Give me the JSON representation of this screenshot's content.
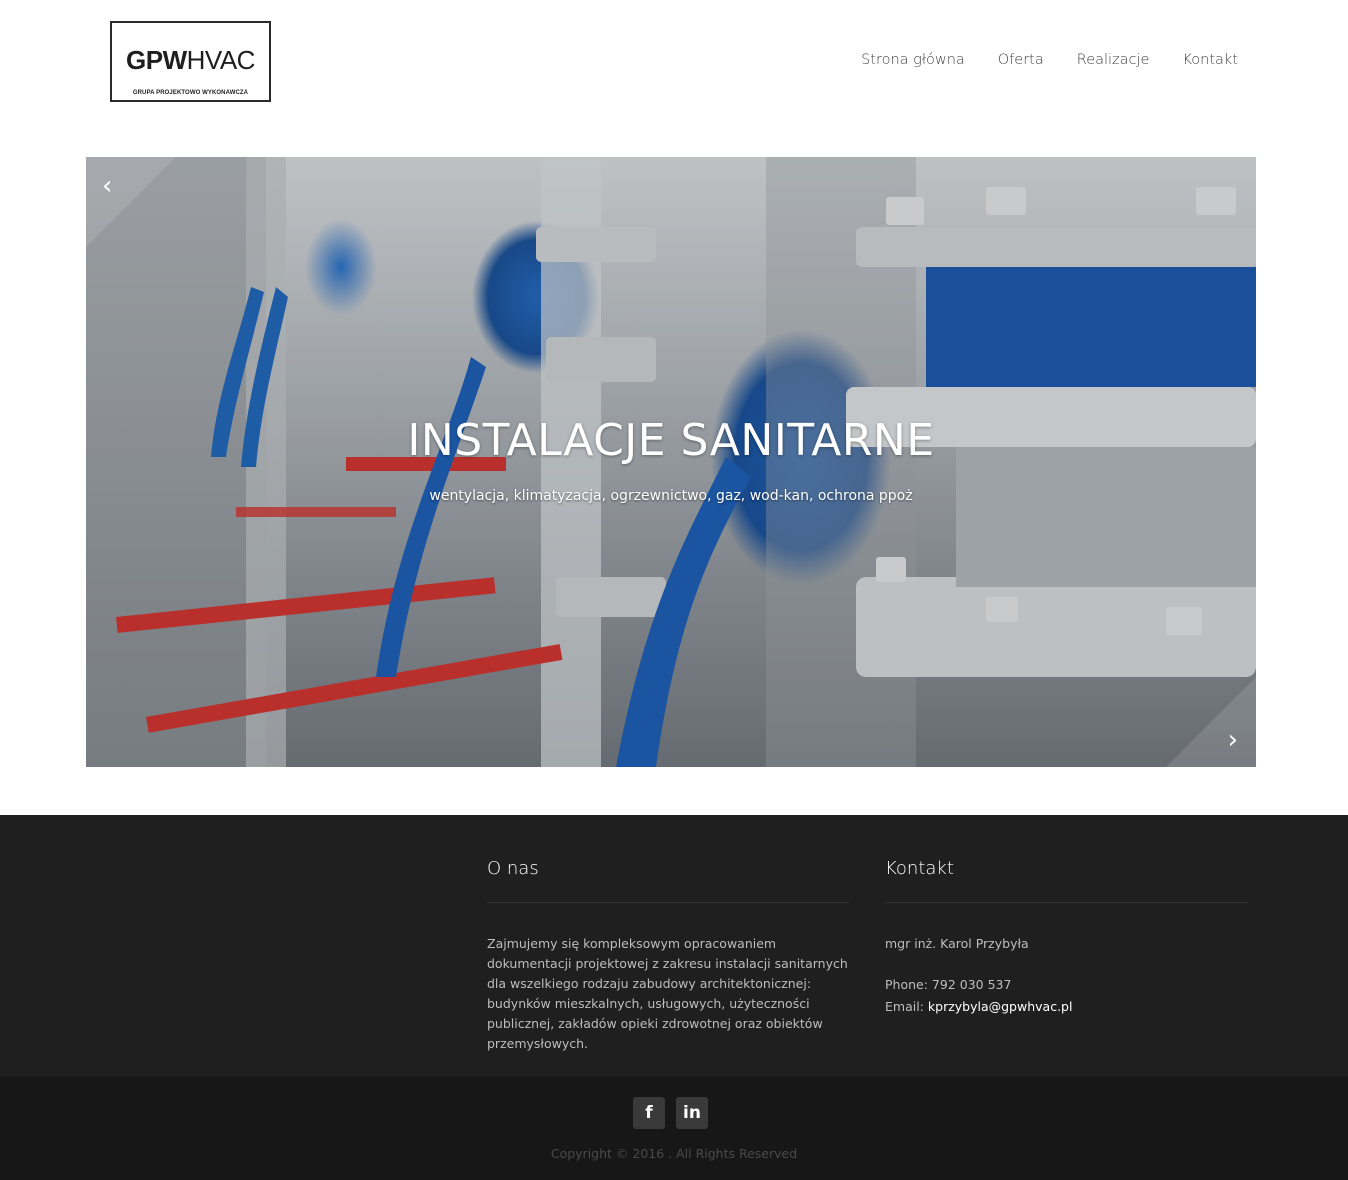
{
  "logo": {
    "title_bold": "GPW",
    "title_light": "HVAC",
    "subtitle": "GRUPA PROJEKTOWO WYKONAWCZA"
  },
  "nav": [
    {
      "label": "Strona główna"
    },
    {
      "label": "Oferta"
    },
    {
      "label": "Realizacje"
    },
    {
      "label": "Kontakt"
    }
  ],
  "slider": {
    "title": "INSTALACJE SANITARNE",
    "subtitle": "wentylacja, klimatyzacja, ogrzewnictwo, gaz, wod-kan, ochrona ppoż",
    "prev_icon": "chevron-left-icon",
    "next_icon": "chevron-right-icon"
  },
  "footer": {
    "about": {
      "heading": "O nas",
      "text": "Zajmujemy się kompleksowym opracowaniem dokumentacji projektowej z zakresu instalacji sanitarnych dla wszelkiego rodzaju zabudowy architektonicznej: budynków mieszkalnych, usługowych, użyteczności publicznej, zakładów opieki zdrowotnej oraz obiektów przemysłowych."
    },
    "contact": {
      "heading": "Kontakt",
      "name": "mgr inż. Karol Przybyła",
      "phone_label": "Phone:",
      "phone": "792 030 537",
      "email_label": "Email:",
      "email": "kprzybyla@gpwhvac.pl"
    }
  },
  "bottom": {
    "social": [
      {
        "icon": "facebook-icon",
        "glyph": "f"
      },
      {
        "icon": "linkedin-icon",
        "glyph": "in"
      }
    ],
    "copyright": "Copyright © 2016 . All Rights Reserved"
  },
  "colors": {
    "footer_bg": "#1f1f1f",
    "bottom_bg": "#171717",
    "accent_blue": "#1f5fb0"
  }
}
